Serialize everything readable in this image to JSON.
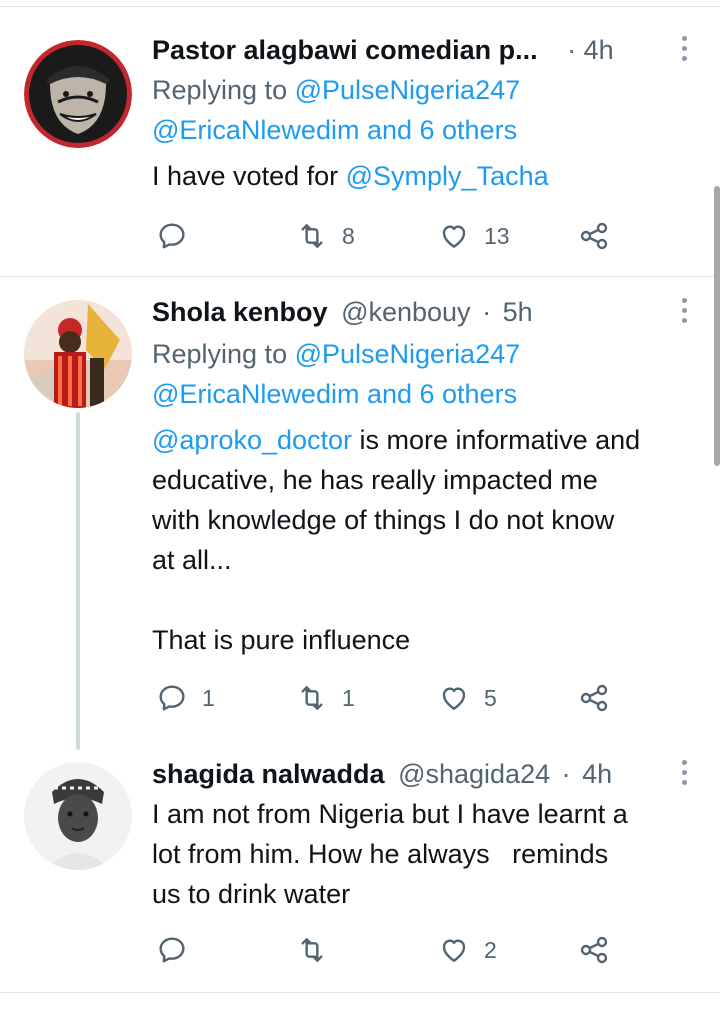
{
  "tweets": [
    {
      "name": "Pastor alagbawi comedian p...",
      "handle": "",
      "time": "4h",
      "replying_prefix": "Replying to ",
      "replying_first": "@PulseNigeria247",
      "replying_second": "@EricaNlewedim and 6 others",
      "body_prefix": "I have voted for ",
      "body_mention": "@Symply_Tacha",
      "reply_count": "",
      "retweet_count": "8",
      "like_count": "13"
    },
    {
      "name": "Shola kenboy",
      "handle": "@kenbouy",
      "time": "5h",
      "replying_prefix": "Replying to ",
      "replying_first": "@PulseNigeria247",
      "replying_second": "@EricaNlewedim and 6 others",
      "body_mention": "@aproko_doctor",
      "body_line1_rest": " is more informative and",
      "body_line2": "educative, he has really impacted me",
      "body_line3": "with knowledge of things I do not know",
      "body_line4": "at all...",
      "body_line5": "That is pure influence",
      "reply_count": "1",
      "retweet_count": "1",
      "like_count": "5"
    },
    {
      "name": "shagida nalwadda",
      "handle": "@shagida24",
      "time": "4h",
      "body_line1": "I am  not from Nigeria but I have learnt a",
      "body_line2": "lot from him. How he always   reminds",
      "body_line3": "us to drink water",
      "reply_count": "",
      "retweet_count": "",
      "like_count": "2"
    }
  ],
  "separator": "·",
  "icons": {
    "reply": "reply-icon",
    "retweet": "retweet-icon",
    "like": "heart-icon",
    "share": "share-icon",
    "more": "more-options-icon"
  },
  "colors": {
    "text": "#0f1419",
    "secondary": "#536471",
    "mention": "#1d9bf0",
    "divider": "#e1e5e8"
  }
}
